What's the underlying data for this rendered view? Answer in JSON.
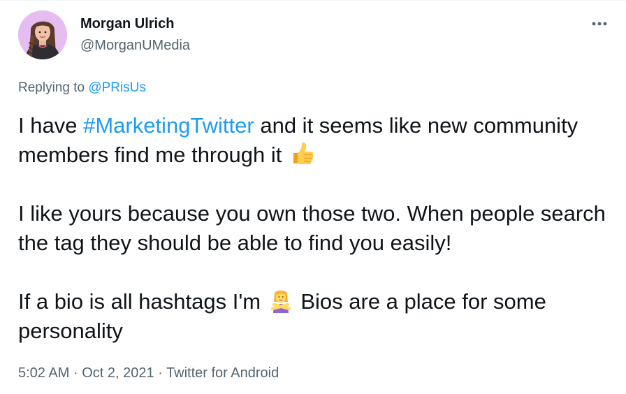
{
  "author": {
    "display_name": "Morgan Ulrich",
    "handle": "@MorganUMedia",
    "avatar_icon": "profile-avatar"
  },
  "menu": {
    "icon": "more-horizontal-icon"
  },
  "reply": {
    "prefix": "Replying to",
    "mention": "@PRisUs"
  },
  "body": {
    "p1_before": "I have",
    "hashtag": "#MarketingTwitter",
    "p1_after": "and it seems like new community members find me through it",
    "p1_emoji": "thumbs-up-icon",
    "p2": "I like yours because you own those two. When people search the tag they should be able to find you easily!",
    "p3_before": "If a bio is all hashtags I'm",
    "p3_emoji": "person-gesturing-no-icon",
    "p3_after": "Bios are a place for some personality"
  },
  "footer": {
    "time": "5:02 AM",
    "separator": "·",
    "date": "Oct 2, 2021",
    "source": "Twitter for Android"
  },
  "colors": {
    "link": "#1d9bf0",
    "text": "#0f1419",
    "secondary": "#536471",
    "divider": "#eff3f4"
  }
}
